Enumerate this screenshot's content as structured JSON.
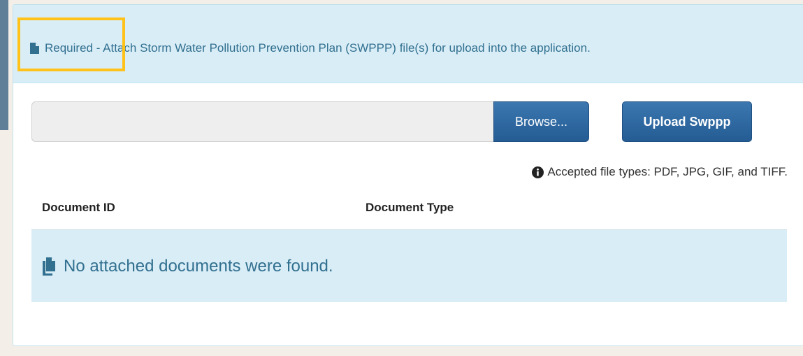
{
  "panel": {
    "heading_text": "Required - Attach Storm Water Pollution Prevention Plan (SWPPP) file(s) for upload into the application.",
    "heading_icon": "file-icon"
  },
  "upload": {
    "file_value": "",
    "browse_label": "Browse...",
    "upload_label": "Upload Swppp",
    "accepted_text": "Accepted file types: PDF, JPG, GIF, and TIFF.",
    "info_icon": "info-circle-icon"
  },
  "table": {
    "columns": [
      "Document ID",
      "Document Type"
    ],
    "empty_message": "No attached documents were found.",
    "empty_icon": "files-icon"
  },
  "colors": {
    "info_bg": "#d9edf7",
    "info_text": "#31708f",
    "button_primary": "#2f6ba3",
    "highlight": "#ffc21a"
  }
}
